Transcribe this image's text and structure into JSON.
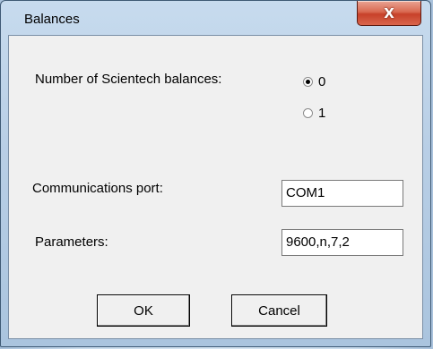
{
  "window": {
    "title": "Balances",
    "close_label": "X"
  },
  "balances": {
    "label": "Number of Scientech balances:",
    "options": [
      {
        "label": "0",
        "selected": true
      },
      {
        "label": "1",
        "selected": false
      }
    ]
  },
  "port": {
    "label": "Communications port:",
    "value": "COM1"
  },
  "parameters": {
    "label": "Parameters:",
    "value": "9600,n,7,2"
  },
  "buttons": {
    "ok": "OK",
    "cancel": "Cancel"
  }
}
